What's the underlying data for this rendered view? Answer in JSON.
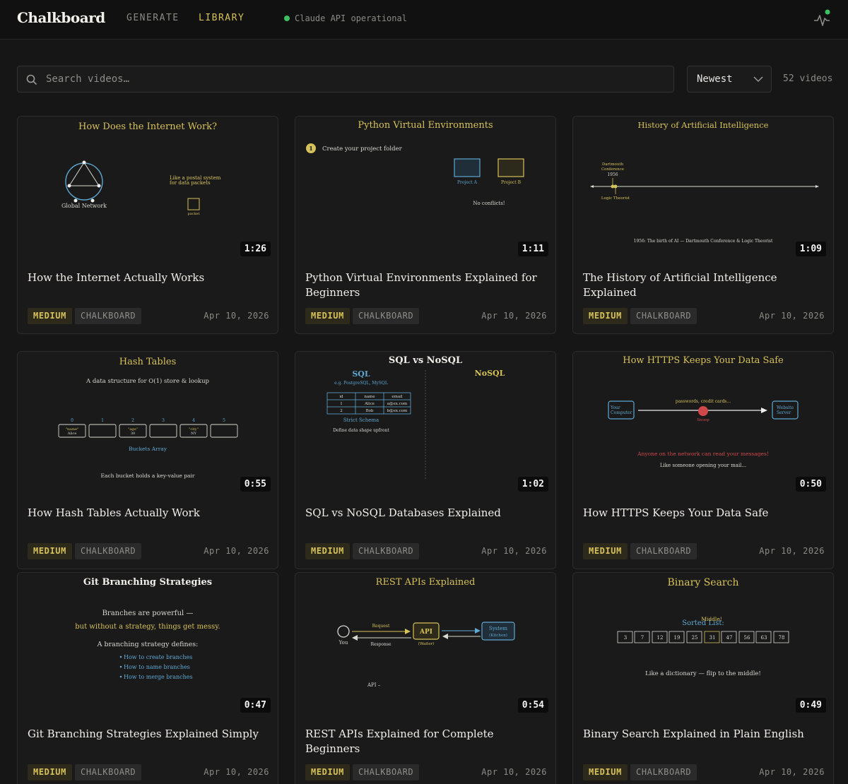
{
  "header": {
    "logo": "Chalkboard",
    "nav": [
      {
        "label": "GENERATE",
        "active": false
      },
      {
        "label": "LIBRARY",
        "active": true
      }
    ],
    "status_text": "Claude API operational",
    "status_color": "#3cc160",
    "activity_icon": "activity-pulse-icon"
  },
  "toolbar": {
    "search_placeholder": "Search videos…",
    "search_value": "",
    "sort_label": "Newest",
    "video_count": "52 videos"
  },
  "colors": {
    "accent": "#d6c15a",
    "background": "#161616",
    "chalk_blue": "#5fa8d3",
    "chalk_red": "#d0484a"
  },
  "cards": [
    {
      "thumb": {
        "heading": "How Does the Internet Work?",
        "label_network": "Global Network",
        "note": "Like a postal system",
        "note2": "for data packets",
        "packet": "packet"
      },
      "duration": "1:26",
      "title": "How the Internet Actually Works",
      "difficulty": "MEDIUM",
      "style": "CHALKBOARD",
      "date": "Apr 10, 2026"
    },
    {
      "thumb": {
        "heading": "Python Virtual Environments",
        "step_num": "1",
        "step_text": "Create your project folder",
        "box_a": "Project A",
        "box_b": "Project B",
        "note": "No conflicts!"
      },
      "duration": "1:11",
      "title": "Python Virtual Environments Explained for Beginners",
      "difficulty": "MEDIUM",
      "style": "CHALKBOARD",
      "date": "Apr 10, 2026"
    },
    {
      "thumb": {
        "heading": "History of Artificial Intelligence",
        "event_top_1": "Dartmouth",
        "event_top_2": "Conference",
        "event_year": "1956",
        "event_bottom": "Logic Theorist",
        "caption": "1956: The birth of AI — Dartmouth Conference & Logic Theorist"
      },
      "duration": "1:09",
      "title": "The History of Artificial Intelligence Explained",
      "difficulty": "MEDIUM",
      "style": "CHALKBOARD",
      "date": "Apr 10, 2026"
    },
    {
      "thumb": {
        "heading": "Hash Tables",
        "subtitle": "A data structure for O(1) store & lookup",
        "indices": [
          "0",
          "1",
          "2",
          "3",
          "4",
          "5"
        ],
        "bucket_key_0": "\"name\"",
        "bucket_val_0": "Alice",
        "bucket_key_2": "\"age\"",
        "bucket_val_2": "30",
        "bucket_key_4": "\"city\"",
        "bucket_val_4": "NY",
        "array_label": "Buckets Array",
        "footnote": "Each bucket holds a key-value pair"
      },
      "duration": "0:55",
      "title": "How Hash Tables Actually Work",
      "difficulty": "MEDIUM",
      "style": "CHALKBOARD",
      "date": "Apr 10, 2026"
    },
    {
      "thumb": {
        "heading": "SQL vs NoSQL",
        "left_title": "SQL",
        "left_sub": "e.g. PostgreSQL, MySQL",
        "table_headers": [
          "id",
          "name",
          "email"
        ],
        "table_rows": [
          [
            "1",
            "Alice",
            "a@ex.com"
          ],
          [
            "2",
            "Bob",
            "b@ex.com"
          ]
        ],
        "schema_label": "Strict Schema",
        "schema_note": "Define data shape upfront",
        "right_title": "NoSQL"
      },
      "duration": "1:02",
      "title": "SQL vs NoSQL Databases Explained",
      "difficulty": "MEDIUM",
      "style": "CHALKBOARD",
      "date": "Apr 10, 2026"
    },
    {
      "thumb": {
        "heading": "How HTTPS Keeps Your Data Safe",
        "left_box_1": "Your",
        "left_box_2": "Computer",
        "right_box_1": "Website",
        "right_box_2": "Server",
        "payload": "passwords, credit cards...",
        "snoop": "Snoop",
        "warning": "Anyone on the network can read your messages!",
        "analogy": "Like someone opening your mail..."
      },
      "duration": "0:50",
      "title": "How HTTPS Keeps Your Data Safe",
      "difficulty": "MEDIUM",
      "style": "CHALKBOARD",
      "date": "Apr 10, 2026"
    },
    {
      "thumb": {
        "heading": "Git Branching Strategies",
        "line1": "Branches are powerful —",
        "line2": "but without a strategy, things get messy.",
        "line3": "A branching strategy defines:",
        "bullets": [
          "How to create branches",
          "How to name branches",
          "How to merge branches"
        ]
      },
      "duration": "0:47",
      "title": "Git Branching Strategies Explained Simply",
      "difficulty": "MEDIUM",
      "style": "CHALKBOARD",
      "date": "Apr 10, 2026"
    },
    {
      "thumb": {
        "heading": "REST APIs Explained",
        "you": "You",
        "request": "Request",
        "response": "Response",
        "api": "API",
        "api_sub": "(Waiter)",
        "system_1": "System",
        "system_2": "(Kitchen)",
        "stray": "API –"
      },
      "duration": "0:54",
      "title": "REST APIs Explained for Complete Beginners",
      "difficulty": "MEDIUM",
      "style": "CHALKBOARD",
      "date": "Apr 10, 2026"
    },
    {
      "thumb": {
        "heading": "Binary Search",
        "middle": "Middle!",
        "sorted": "Sorted List:",
        "numbers": [
          "3",
          "7",
          "12",
          "19",
          "25",
          "31",
          "47",
          "56",
          "63",
          "78"
        ],
        "analogy": "Like a dictionary — flip to the middle!"
      },
      "duration": "0:49",
      "title": "Binary Search Explained in Plain English",
      "difficulty": "MEDIUM",
      "style": "CHALKBOARD",
      "date": "Apr 10, 2026"
    }
  ]
}
